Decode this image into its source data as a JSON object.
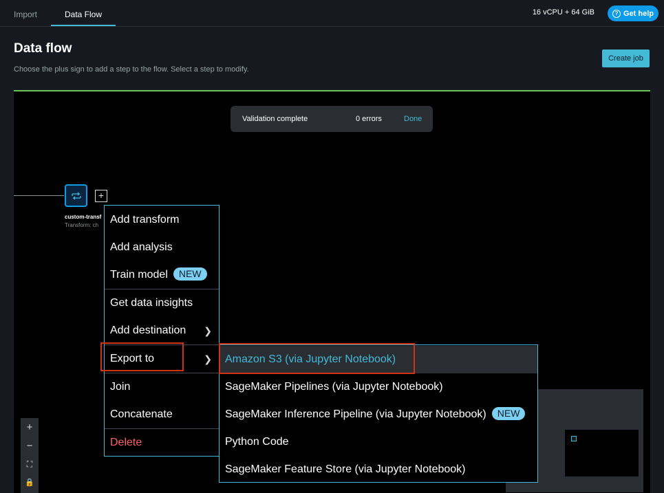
{
  "tabs": [
    {
      "label": "Import"
    },
    {
      "label": "Data Flow"
    }
  ],
  "resources": "16 vCPU + 64 GiB",
  "help_button": "Get help",
  "page": {
    "title": "Data flow",
    "subtitle": "Choose the plus sign to add a step to the flow. Select a step to modify.",
    "create_button": "Create job"
  },
  "toast": {
    "message": "Validation complete",
    "errors": "0 errors",
    "action": "Done"
  },
  "node": {
    "name": "custom-transf",
    "subtitle": "Transform: ch"
  },
  "zoom_controls": [
    "+",
    "−",
    "⛶",
    "🔒"
  ],
  "menu": {
    "add_transform": "Add transform",
    "add_analysis": "Add analysis",
    "train_model": "Train model",
    "new_badge": "NEW",
    "get_data_insights": "Get data insights",
    "add_destination": "Add destination",
    "export_to": "Export to",
    "join": "Join",
    "concatenate": "Concatenate",
    "delete": "Delete"
  },
  "submenu": {
    "s3": "Amazon S3 (via Jupyter Notebook)",
    "pipelines": "SageMaker Pipelines (via Jupyter Notebook)",
    "inference": "SageMaker Inference Pipeline (via Jupyter Notebook)",
    "new_badge": "NEW",
    "python": "Python Code",
    "feature_store": "SageMaker Feature Store (via Jupyter Notebook)"
  },
  "colors": {
    "accent": "#44b9d6",
    "highlight_border": "#d13212",
    "delete_text": "#ff5d64",
    "canvas_top_border": "#6ac259"
  }
}
